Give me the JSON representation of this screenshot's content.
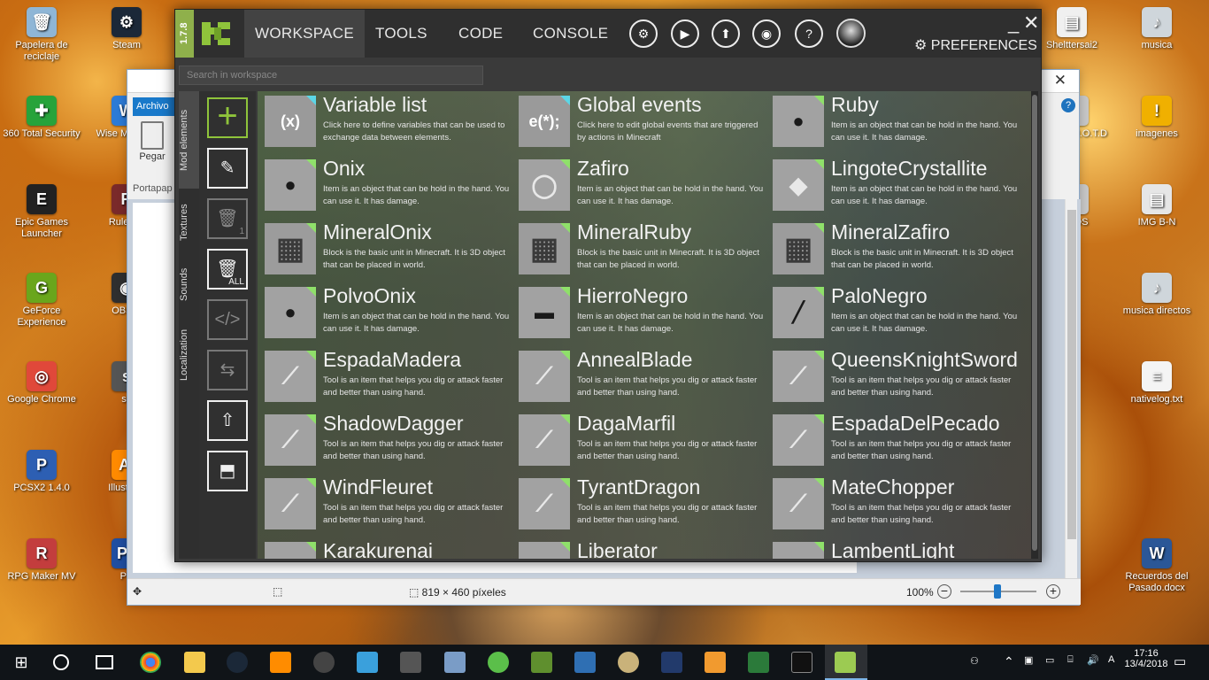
{
  "desktop": {
    "icons_left": [
      {
        "label": "Papelera de reciclaje",
        "color": "#8fb6d6",
        "glyph": "🗑"
      },
      {
        "label": "Steam",
        "color": "#1b2838",
        "glyph": "⚙"
      },
      {
        "label": "360 Total Security",
        "color": "#27a33b",
        "glyph": "✚"
      },
      {
        "label": "Wise M Optim",
        "color": "#2c7bd6",
        "glyph": "W"
      },
      {
        "label": "Epic Games Launcher",
        "color": "#222222",
        "glyph": "E"
      },
      {
        "label": "Rules of",
        "color": "#7a2a2a",
        "glyph": "R"
      },
      {
        "label": "GeForce Experience",
        "color": "#6aa61c",
        "glyph": "G"
      },
      {
        "label": "OBS S",
        "color": "#2f2f2f",
        "glyph": "◉"
      },
      {
        "label": "Google Chrome",
        "color": "#e0483a",
        "glyph": "◎"
      },
      {
        "label": "sa",
        "color": "#555555",
        "glyph": "s"
      },
      {
        "label": "PCSX2 1.4.0",
        "color": "#2d5fb3",
        "glyph": "P"
      },
      {
        "label": "Illustrato",
        "color": "#ff8a00",
        "glyph": "Ai"
      },
      {
        "label": "RPG Maker MV",
        "color": "#c33d3d",
        "glyph": "R"
      },
      {
        "label": "PS",
        "color": "#1f4ea1",
        "glyph": "Ps"
      }
    ],
    "icons_right": [
      {
        "label": "Shelttersai2",
        "color": "#f0f0f0",
        "glyph": "▤"
      },
      {
        "label": "musica",
        "color": "#cfd6db",
        "glyph": "♪"
      },
      {
        "label": "imagenes",
        "color": "#f0b000",
        "glyph": "!"
      },
      {
        "label": "para el H.O.T.D",
        "color": "#c8c8c8",
        "glyph": ""
      },
      {
        "label": "brir nt 3D",
        "color": "#d45cc4",
        "glyph": ""
      },
      {
        "label": "MODS",
        "color": "#c8c8c8",
        "glyph": ""
      },
      {
        "label": "IMG B-N",
        "color": "#e6e6e6",
        "glyph": "▤"
      },
      {
        "label": "musica directos",
        "color": "#cfd6db",
        "glyph": "♪"
      },
      {
        "label": "nativelog.txt",
        "color": "#f4f4f4",
        "glyph": "≡"
      },
      {
        "label": "Recuerdos del Pasado.docx",
        "color": "#2b5797",
        "glyph": "W"
      }
    ]
  },
  "paint": {
    "menu_label": "Archivo",
    "paste_label": "Pegar",
    "clipboard_label": "Portapap",
    "status_dimensions": "819 × 460 píxeles",
    "zoom_label": "100%",
    "zoom_level_percent": 100
  },
  "mcreator": {
    "version": "1.7.8",
    "nav": [
      "WORKSPACE",
      "TOOLS",
      "CODE",
      "CONSOLE"
    ],
    "active_nav": "WORKSPACE",
    "preferences_label": "PREFERENCES",
    "search_placeholder": "Search in workspace",
    "side_tabs": [
      "Mod elements",
      "Textures",
      "Sounds",
      "Localization"
    ],
    "tool_sub_labels": {
      "delete_one": "1",
      "delete_all": "ALL"
    },
    "elements": [
      {
        "name": "Variable list",
        "desc": "Click here to define variables that can be used to exchange data between elements.",
        "glyph": "(x)",
        "corner": "cyan",
        "thumb": "#9a9a9a"
      },
      {
        "name": "Global events",
        "desc": "Click here to edit global events that are triggered by actions in Minecraft",
        "glyph": "e(*);",
        "corner": "cyan",
        "thumb": "#9a9a9a"
      },
      {
        "name": "Ruby",
        "desc": "Item is an object that can be hold in the hand. You can use it. It has damage.",
        "glyph": "●",
        "corner": "green",
        "thumb": "#a2a2a2"
      },
      {
        "name": "Onix",
        "desc": "Item is an object that can be hold in the hand. You can use it. It has damage.",
        "glyph": "●",
        "corner": "green",
        "thumb": "#a2a2a2"
      },
      {
        "name": "Zafiro",
        "desc": "Item is an object that can be hold in the hand. You can use it. It has damage.",
        "glyph": "◯",
        "corner": "green",
        "thumb": "#a2a2a2"
      },
      {
        "name": "LingoteCrystallite",
        "desc": "Item is an object that can be hold in the hand. You can use it. It has damage.",
        "glyph": "◆",
        "corner": "green",
        "thumb": "#a2a2a2"
      },
      {
        "name": "MineralOnix",
        "desc": "Block is the basic unit in Minecraft. It is 3D object that can be placed in world.",
        "glyph": "▦",
        "corner": "green",
        "thumb": "#9c9c9c"
      },
      {
        "name": "MineralRuby",
        "desc": "Block is the basic unit in Minecraft. It is 3D object that can be placed in world.",
        "glyph": "▦",
        "corner": "green",
        "thumb": "#9c9c9c"
      },
      {
        "name": "MineralZafiro",
        "desc": "Block is the basic unit in Minecraft. It is 3D object that can be placed in world.",
        "glyph": "▦",
        "corner": "green",
        "thumb": "#9c9c9c"
      },
      {
        "name": "PolvoOnix",
        "desc": "Item is an object that can be hold in the hand. You can use it. It has damage.",
        "glyph": "●",
        "corner": "green",
        "thumb": "#a2a2a2"
      },
      {
        "name": "HierroNegro",
        "desc": "Item is an object that can be hold in the hand. You can use it. It has damage.",
        "glyph": "▬",
        "corner": "green",
        "thumb": "#a2a2a2"
      },
      {
        "name": "PaloNegro",
        "desc": "Item is an object that can be hold in the hand. You can use it. It has damage.",
        "glyph": "╱",
        "corner": "green",
        "thumb": "#a2a2a2"
      },
      {
        "name": "EspadaMadera",
        "desc": "Tool is an item that helps you dig or attack faster and better than using hand.",
        "glyph": "⟋",
        "corner": "green",
        "thumb": "#a2a2a2"
      },
      {
        "name": "AnnealBlade",
        "desc": "Tool is an item that helps you dig or attack faster and better than using hand.",
        "glyph": "⟋",
        "corner": "green",
        "thumb": "#a2a2a2"
      },
      {
        "name": "QueensKnightSword",
        "desc": "Tool is an item that helps you dig or attack faster and better than using hand.",
        "glyph": "⟋",
        "corner": "green",
        "thumb": "#a2a2a2"
      },
      {
        "name": "ShadowDagger",
        "desc": "Tool is an item that helps you dig or attack faster and better than using hand.",
        "glyph": "⟋",
        "corner": "green",
        "thumb": "#a2a2a2"
      },
      {
        "name": "DagaMarfil",
        "desc": "Tool is an item that helps you dig or attack faster and better than using hand.",
        "glyph": "⟋",
        "corner": "green",
        "thumb": "#a2a2a2"
      },
      {
        "name": "EspadaDelPecado",
        "desc": "Tool is an item that helps you dig or attack faster and better than using hand.",
        "glyph": "⟋",
        "corner": "green",
        "thumb": "#a2a2a2"
      },
      {
        "name": "WindFleuret",
        "desc": "Tool is an item that helps you dig or attack faster and better than using hand.",
        "glyph": "⟋",
        "corner": "green",
        "thumb": "#a2a2a2"
      },
      {
        "name": "TyrantDragon",
        "desc": "Tool is an item that helps you dig or attack faster and better than using hand.",
        "glyph": "⟋",
        "corner": "green",
        "thumb": "#a2a2a2"
      },
      {
        "name": "MateChopper",
        "desc": "Tool is an item that helps you dig or attack faster and better than using hand.",
        "glyph": "⟋",
        "corner": "green",
        "thumb": "#a2a2a2"
      },
      {
        "name": "Karakurenai",
        "desc": "",
        "glyph": "",
        "corner": "green",
        "thumb": "#a2a2a2"
      },
      {
        "name": "Liberator",
        "desc": "",
        "glyph": "",
        "corner": "green",
        "thumb": "#a2a2a2"
      },
      {
        "name": "LambentLight",
        "desc": "",
        "glyph": "",
        "corner": "green",
        "thumb": "#a2a2a2"
      }
    ]
  },
  "taskbar": {
    "time": "17:16",
    "date": "13/4/2018"
  },
  "colors": {
    "mcreator_accent": "#8fc43b",
    "paint_accent": "#1979ca"
  }
}
